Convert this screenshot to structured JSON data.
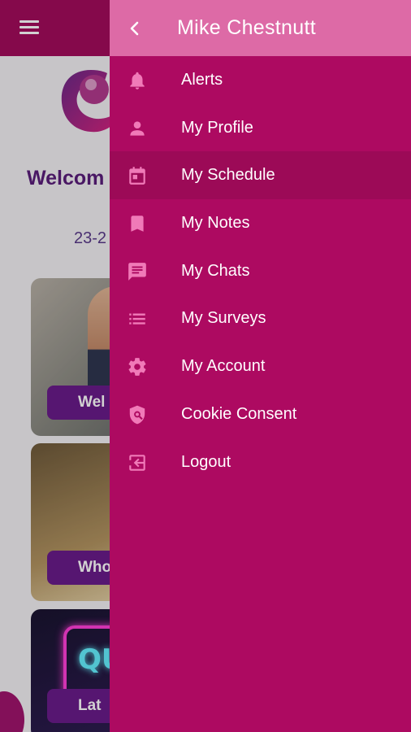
{
  "background": {
    "welcome_text": "Welcom",
    "date_text": "23-2",
    "cards": [
      {
        "label": "Wel"
      },
      {
        "label": "Who"
      },
      {
        "label": "Lat"
      }
    ]
  },
  "drawer": {
    "user_name": "Mike Chestnutt",
    "menu": [
      {
        "label": "Alerts",
        "icon": "bell-icon"
      },
      {
        "label": "My Profile",
        "icon": "person-icon"
      },
      {
        "label": "My Schedule",
        "icon": "calendar-icon",
        "active": true
      },
      {
        "label": "My Notes",
        "icon": "bookmark-icon"
      },
      {
        "label": "My Chats",
        "icon": "chat-icon"
      },
      {
        "label": "My Surveys",
        "icon": "list-icon"
      },
      {
        "label": "My Account",
        "icon": "gear-icon"
      },
      {
        "label": "Cookie Consent",
        "icon": "shield-icon"
      },
      {
        "label": "Logout",
        "icon": "logout-icon"
      }
    ]
  },
  "colors": {
    "drawer_bg": "#ad0a61",
    "drawer_header_bg": "#dd6aa6",
    "icon_color": "#f07ab8",
    "app_bar_bg": "#a30c5c"
  }
}
